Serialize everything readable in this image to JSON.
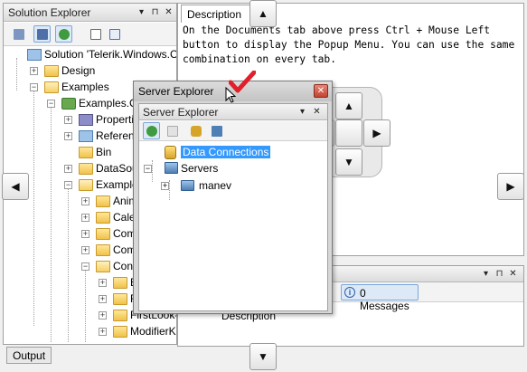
{
  "solution_explorer": {
    "title": "Solution Explorer",
    "title_buttons": [
      "▾",
      "⊓",
      "✕"
    ],
    "toolbar_icons": [
      "show-all-files-icon",
      "properties-icon",
      "refresh-icon",
      "view-code-icon",
      "class-view-icon"
    ],
    "tree": [
      {
        "label": "Solution 'Telerik.Windows.Co",
        "level": 0,
        "expander": "",
        "icon": "solution-icon"
      },
      {
        "label": "Design",
        "level": 1,
        "expander": "+",
        "icon": "folder-icon"
      },
      {
        "label": "Examples",
        "level": 1,
        "expander": "−",
        "icon": "folder-open-icon"
      },
      {
        "label": "Examples.CS",
        "level": 2,
        "expander": "−",
        "icon": "csharp-project-icon"
      },
      {
        "label": "Properties",
        "level": 3,
        "expander": "+",
        "icon": "properties-icon"
      },
      {
        "label": "Reference",
        "level": 3,
        "expander": "+",
        "icon": "references-icon"
      },
      {
        "label": "Bin",
        "level": 3,
        "expander": "",
        "icon": "folder-icon"
      },
      {
        "label": "DataSource",
        "level": 3,
        "expander": "+",
        "icon": "folder-icon"
      },
      {
        "label": "Examples",
        "level": 3,
        "expander": "−",
        "icon": "folder-open-icon"
      },
      {
        "label": "Anima",
        "level": 4,
        "expander": "+",
        "icon": "folder-icon"
      },
      {
        "label": "Calend",
        "level": 4,
        "expander": "+",
        "icon": "folder-icon"
      },
      {
        "label": "Comb",
        "level": 4,
        "expander": "+",
        "icon": "folder-icon"
      },
      {
        "label": "Comm",
        "level": 4,
        "expander": "+",
        "icon": "folder-icon"
      },
      {
        "label": "Conte",
        "level": 4,
        "expander": "−",
        "icon": "folder-open-icon"
      },
      {
        "label": "Eve",
        "level": 5,
        "expander": "+",
        "icon": "folder-icon"
      },
      {
        "label": "Fir",
        "level": 5,
        "expander": "+",
        "icon": "folder-icon"
      },
      {
        "label": "FirstLook-C",
        "level": 5,
        "expander": "+",
        "icon": "folder-icon"
      },
      {
        "label": "ModifierKey",
        "level": 5,
        "expander": "+",
        "icon": "folder-icon"
      }
    ]
  },
  "description": {
    "tab_label": "Description",
    "text": "On the Documents tab above press Ctrl + Mouse Left button to display the Popup Menu. You can use the same combination on every tab."
  },
  "bottom_pane": {
    "messages_label": "0 Messages",
    "column_description": "Description",
    "title_buttons": [
      "▾",
      "⊓",
      "✕"
    ]
  },
  "output_tab": {
    "label": "Output"
  },
  "server_explorer_float": {
    "window_title": "Server Explorer",
    "close_glyph": "✕",
    "pane_title": "Server Explorer",
    "pane_title_buttons": [
      "▾",
      "✕"
    ],
    "toolbar_icons": [
      "refresh-icon",
      "delete-icon",
      "connect-database-icon",
      "connect-server-icon"
    ],
    "tree": [
      {
        "label": "Data Connections",
        "icon": "database-icon",
        "selected": true
      },
      {
        "label": "Servers",
        "icon": "servers-icon",
        "expander": "−"
      },
      {
        "label": "manev",
        "icon": "server-icon",
        "expander": "+"
      }
    ]
  },
  "docking_guide": {
    "top": "▲",
    "bottom": "▼",
    "left": "◀",
    "right": "▶"
  }
}
